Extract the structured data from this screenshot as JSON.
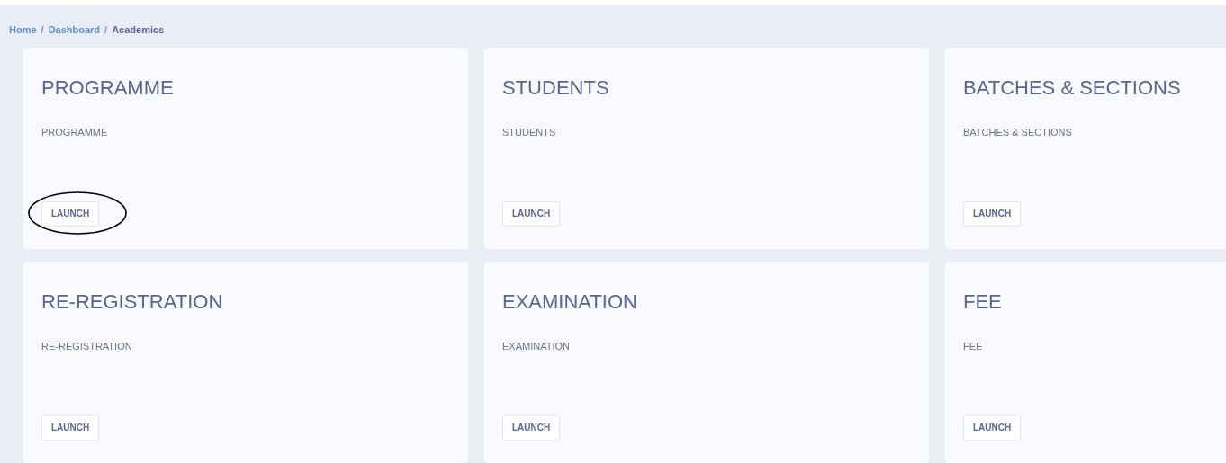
{
  "breadcrumb": [
    {
      "label": "Home",
      "current": false
    },
    {
      "label": "Dashboard",
      "current": false
    },
    {
      "label": "Academics",
      "current": true
    }
  ],
  "breadcrumb_separator": "/",
  "cards": [
    {
      "title": "PROGRAMME",
      "subtitle": "PROGRAMME",
      "button": "LAUNCH",
      "circled": true
    },
    {
      "title": "STUDENTS",
      "subtitle": "STUDENTS",
      "button": "LAUNCH",
      "circled": false
    },
    {
      "title": "BATCHES & SECTIONS",
      "subtitle": "BATCHES & SECTIONS",
      "button": "LAUNCH",
      "circled": false
    },
    {
      "title": "RE-REGISTRATION",
      "subtitle": "RE-REGISTRATION",
      "button": "LAUNCH",
      "circled": false
    },
    {
      "title": "EXAMINATION",
      "subtitle": "EXAMINATION",
      "button": "LAUNCH",
      "circled": false
    },
    {
      "title": "FEE",
      "subtitle": "FEE",
      "button": "LAUNCH",
      "circled": false
    }
  ]
}
